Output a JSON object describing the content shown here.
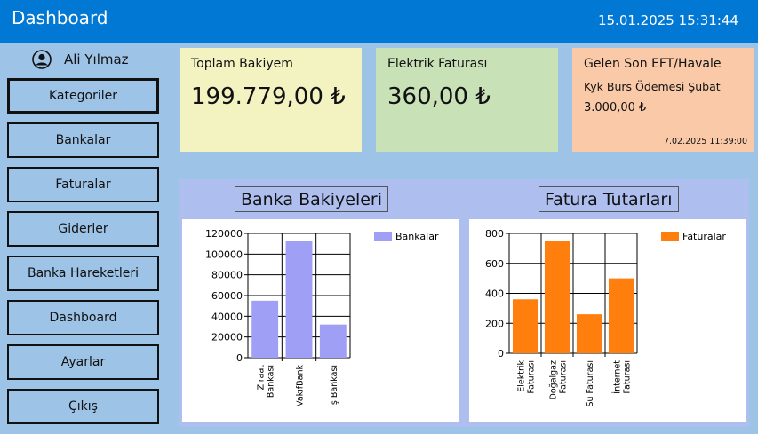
{
  "app": {
    "title": "Dashboard",
    "datetime": "15.01.2025 15:31:44"
  },
  "user": {
    "name": "Ali Yılmaz",
    "icon": "user-circle-icon"
  },
  "nav": [
    {
      "label": "Kategoriler",
      "active": true
    },
    {
      "label": "Bankalar"
    },
    {
      "label": "Faturalar"
    },
    {
      "label": "Giderler"
    },
    {
      "label": "Banka Hareketleri"
    },
    {
      "label": "Dashboard"
    },
    {
      "label": "Ayarlar"
    },
    {
      "label": "Çıkış"
    }
  ],
  "cards": {
    "balance": {
      "label": "Toplam Bakiyem",
      "value": "199.779,00 ₺",
      "color": "#f3f2c1"
    },
    "electric": {
      "label": "Elektrik Faturası",
      "value": "360,00 ₺",
      "color": "#c9e1b6"
    },
    "eft": {
      "label": "Gelen Son EFT/Havale",
      "description": "Kyk Burs Ödemesi Şubat",
      "amount": "3.000,00 ₺",
      "date": "7.02.2025 11:39:00",
      "color": "#f9c9a8"
    }
  },
  "chart_titles": {
    "bank": "Banka Bakiyeleri",
    "bill": "Fatura Tutarları"
  },
  "chart_data": [
    {
      "type": "bar",
      "title": "Banka Bakiyeleri",
      "categories": [
        [
          "Ziraat",
          "Bankası"
        ],
        [
          "VakıfBank"
        ],
        [
          "İş Bankası"
        ]
      ],
      "series": [
        {
          "name": "Bankalar",
          "values": [
            55000,
            112500,
            32000
          ],
          "color": "#9f9ff5"
        }
      ],
      "yticks": [
        "120000",
        "100000",
        "80000",
        "60000",
        "40000",
        "20000",
        "0"
      ],
      "ylim": [
        0,
        120000
      ],
      "grid": true,
      "legend": "top-right"
    },
    {
      "type": "bar",
      "title": "Fatura Tutarları",
      "categories": [
        [
          "Elektrik",
          "Faturası"
        ],
        [
          "Doğalgaz",
          "Faturası"
        ],
        [
          "Su Faturası"
        ],
        [
          "İnternet",
          "Faturası"
        ]
      ],
      "series": [
        {
          "name": "Faturalar",
          "values": [
            360,
            750,
            260,
            500
          ],
          "color": "#ff7f0e"
        }
      ],
      "yticks": [
        "800",
        "600",
        "400",
        "200",
        "0"
      ],
      "ylim": [
        0,
        800
      ],
      "grid": true,
      "legend": "top-right"
    }
  ]
}
